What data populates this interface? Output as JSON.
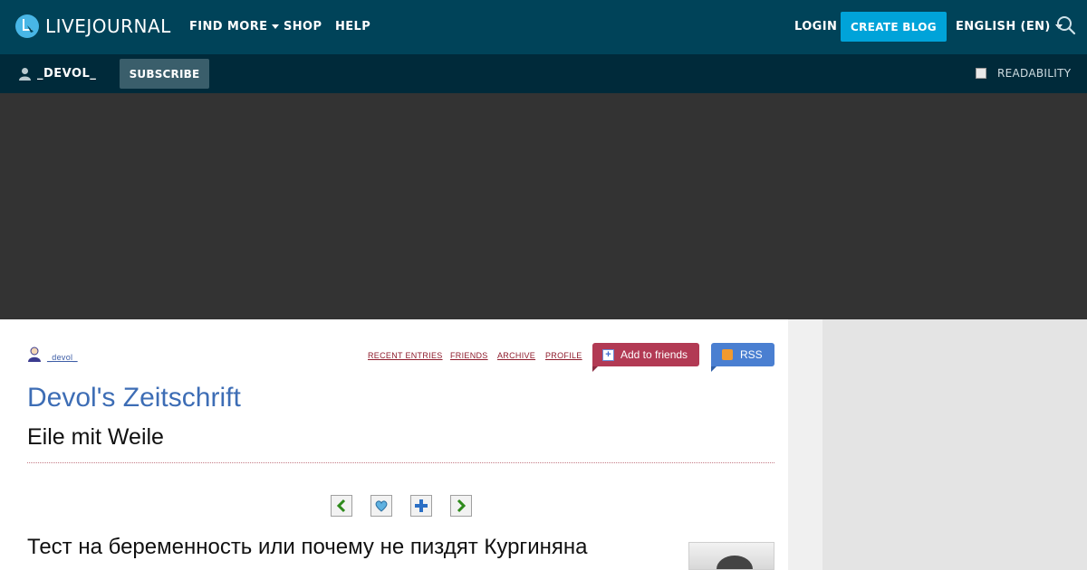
{
  "header": {
    "logo_text": "LIVEJOURNAL",
    "nav": {
      "find_more": "FIND MORE",
      "shop": "SHOP",
      "help": "HELP"
    },
    "login": "LOGIN",
    "create_blog": "CREATE BLOG",
    "language": "ENGLISH (EN)",
    "colors": {
      "bar": "#004359",
      "accent": "#00a3d9"
    }
  },
  "subbar": {
    "username": "_DEVOL_",
    "subscribe": "SUBSCRIBE",
    "readability": "READABILITY",
    "readability_checked": false
  },
  "journal": {
    "user": "_devol_",
    "nav": {
      "recent": "RECENT ENTRIES",
      "friends": "FRIENDS",
      "archive": "ARCHIVE",
      "profile": "PROFILE"
    },
    "add_friends": "Add to friends",
    "rss": "RSS",
    "title": "Devol's Zeitschrift",
    "subtitle": "Eile mit Weile",
    "post_title": "Тест на беременность или почему не пиздят Кургиняна",
    "pager_icons": [
      "arrow-left-icon",
      "heart-icon",
      "plus-icon",
      "arrow-right-icon"
    ]
  }
}
